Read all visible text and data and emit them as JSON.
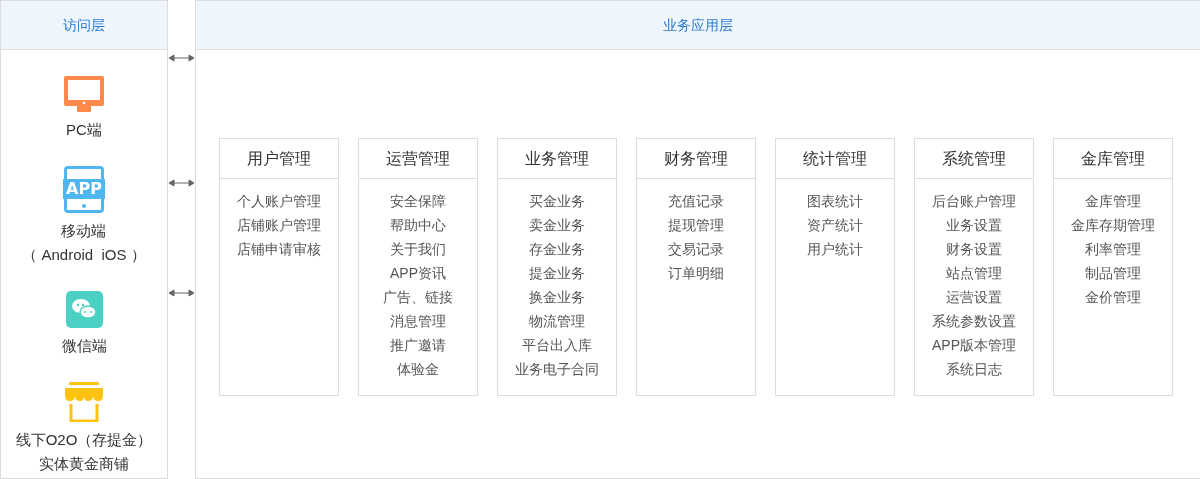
{
  "access_layer": {
    "title": "访问层",
    "clients": [
      {
        "kind": "pc",
        "lines": [
          "PC端"
        ]
      },
      {
        "kind": "app",
        "icon_text": "APP",
        "lines": [
          "移动端",
          "（ Android  iOS ）"
        ]
      },
      {
        "kind": "wechat",
        "lines": [
          "微信端"
        ]
      },
      {
        "kind": "shop",
        "lines": [
          "线下O2O（存提金）",
          "实体黄金商铺"
        ]
      }
    ]
  },
  "business_layer": {
    "title": "业务应用层",
    "modules": [
      {
        "title": "用户管理",
        "items": [
          "个人账户管理",
          "店铺账户管理",
          "店铺申请审核"
        ]
      },
      {
        "title": "运营管理",
        "items": [
          "安全保障",
          "帮助中心",
          "关于我们",
          "APP资讯",
          "广告、链接",
          "消息管理",
          "推广邀请",
          "体验金"
        ]
      },
      {
        "title": "业务管理",
        "items": [
          "买金业务",
          "卖金业务",
          "存金业务",
          "提金业务",
          "换金业务",
          "物流管理",
          "平台出入库",
          "业务电子合同"
        ]
      },
      {
        "title": "财务管理",
        "items": [
          "充值记录",
          "提现管理",
          "交易记录",
          "订单明细"
        ]
      },
      {
        "title": "统计管理",
        "items": [
          "图表统计",
          "资产统计",
          "用户统计"
        ]
      },
      {
        "title": "系统管理",
        "items": [
          "后台账户管理",
          "业务设置",
          "财务设置",
          "站点管理",
          "运营设置",
          "系统参数设置",
          "APP版本管理",
          "系统日志"
        ]
      },
      {
        "title": "金库管理",
        "items": [
          "金库管理",
          "金库存期管理",
          "利率管理",
          "制品管理",
          "金价管理"
        ]
      }
    ]
  }
}
